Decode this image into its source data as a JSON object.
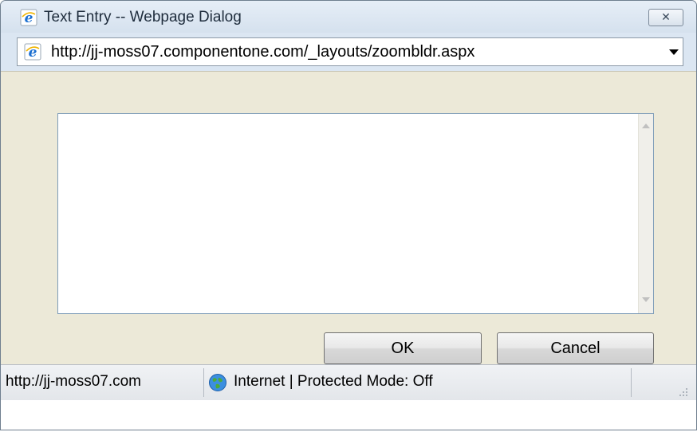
{
  "window": {
    "title": "Text Entry -- Webpage Dialog",
    "close_glyph": "✕",
    "app_icon": "ie-icon"
  },
  "address": {
    "url": "http://jj-moss07.componentone.com/_layouts/zoombldr.aspx",
    "dropdown_icon": "chevron-down-icon"
  },
  "editor": {
    "value": "",
    "placeholder": ""
  },
  "buttons": {
    "ok_label": "OK",
    "cancel_label": "Cancel"
  },
  "status": {
    "url": "http://jj-moss07.com",
    "zone": "Internet | Protected Mode: Off",
    "zone_icon": "globe-icon"
  },
  "colors": {
    "content_bg": "#ece9d8",
    "titlebar_bg": "#dbe6f2"
  }
}
